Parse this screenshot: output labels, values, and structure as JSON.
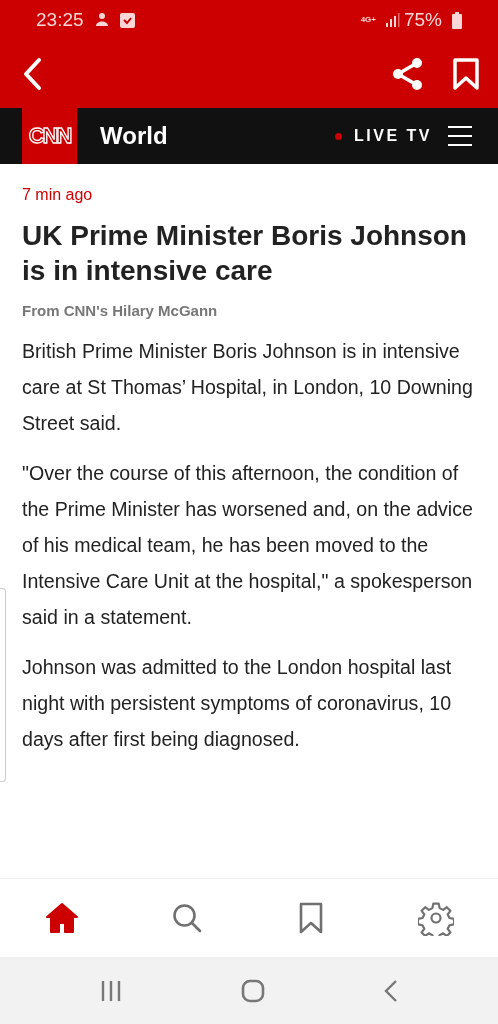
{
  "status_bar": {
    "time": "23:25",
    "network": "4G+",
    "battery": "75%"
  },
  "app_bar": {
    "actions": [
      {
        "kind": "share"
      },
      {
        "kind": "bookmark"
      }
    ]
  },
  "section_bar": {
    "logo": "CNN",
    "section": "World",
    "live": "LIVE TV"
  },
  "article": {
    "time_ago": "7 min ago",
    "headline": "UK Prime Minister Boris Johnson is in intensive care",
    "byline": "From CNN's Hilary McGann",
    "paragraphs": [
      "British Prime Minister Boris Johnson is in intensive care at St Thomas’ Hospital, in London, 10 Downing Street said.",
      "\"Over the course of this afternoon, the condition of the Prime Minister has worsened and, on the advice of his medical team, he has been moved to the Intensive Care Unit at the hospital,\" a spokesperson said in a statement.",
      "Johnson was admitted to the London hospital last night with persistent symptoms of coronavirus, 10 days after first being diagnosed."
    ]
  },
  "bottom_nav": [
    {
      "kind": "home",
      "selected": true
    },
    {
      "kind": "search",
      "selected": false
    },
    {
      "kind": "bookmark",
      "selected": false
    },
    {
      "kind": "settings",
      "selected": false
    }
  ]
}
